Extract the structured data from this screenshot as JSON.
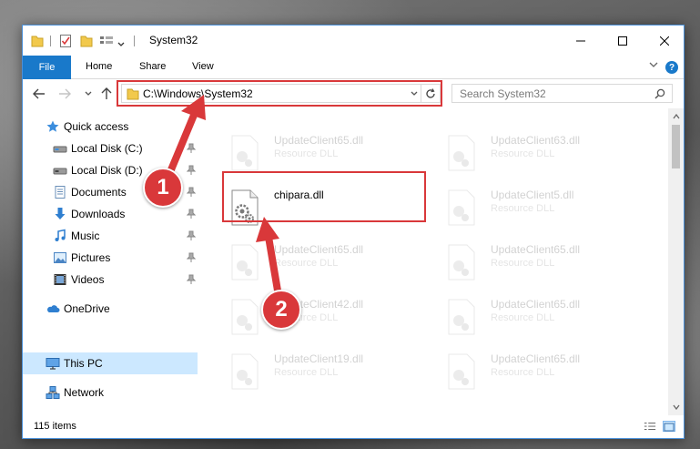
{
  "window": {
    "title": "System32"
  },
  "ribbon": {
    "tabs": [
      "File",
      "Home",
      "Share",
      "View"
    ],
    "help_label": "?"
  },
  "address": {
    "path": "C:\\Windows\\System32",
    "search_placeholder": "Search System32"
  },
  "nav": {
    "items": [
      {
        "label": "Quick access",
        "icon": "star-icon"
      },
      {
        "label": "Local Disk (C:)",
        "icon": "drive-icon"
      },
      {
        "label": "Local Disk (D:)",
        "icon": "drive-icon"
      },
      {
        "label": "Documents",
        "icon": "documents-icon"
      },
      {
        "label": "Downloads",
        "icon": "download-icon"
      },
      {
        "label": "Music",
        "icon": "music-icon"
      },
      {
        "label": "Pictures",
        "icon": "pictures-icon"
      },
      {
        "label": "Videos",
        "icon": "videos-icon"
      },
      {
        "label": "OneDrive",
        "icon": "cloud-icon"
      },
      {
        "label": "This PC",
        "icon": "computer-icon"
      },
      {
        "label": "Network",
        "icon": "network-icon"
      }
    ]
  },
  "files": [
    {
      "name": "UpdateClient65.dll",
      "type": "Resource DLL"
    },
    {
      "name": "UpdateClient63.dll",
      "type": "Resource DLL"
    },
    {
      "name": "chipara.dll",
      "type": ""
    },
    {
      "name": "UpdateClient5.dll",
      "type": "Resource DLL"
    },
    {
      "name": "UpdateClient65.dll",
      "type": "Resource DLL"
    },
    {
      "name": "UpdateClient65.dll",
      "type": "Resource DLL"
    },
    {
      "name": "UpdateClient42.dll",
      "type": "Resource DLL"
    },
    {
      "name": "UpdateClient65.dll",
      "type": "Resource DLL"
    },
    {
      "name": "UpdateClient19.dll",
      "type": "Resource DLL"
    },
    {
      "name": "UpdateClient65.dll",
      "type": "Resource DLL"
    }
  ],
  "status": {
    "item_count": "115 items"
  },
  "annotations": {
    "step1": "1",
    "step2": "2",
    "color": "#d9383a"
  },
  "colors": {
    "accent": "#1979ca",
    "selection": "#cce8ff"
  }
}
